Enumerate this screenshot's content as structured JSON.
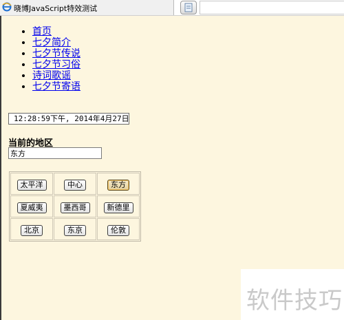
{
  "window": {
    "tab_title": "晓博JavaScript特效测试"
  },
  "nav": {
    "items": [
      {
        "label": "首页"
      },
      {
        "label": "七夕简介"
      },
      {
        "label": "七夕节传说"
      },
      {
        "label": "七夕节习俗"
      },
      {
        "label": "诗词歌谣"
      },
      {
        "label": "七夕节寄语"
      }
    ]
  },
  "clock": {
    "text": "12:28:59下午, 2014年4月27日"
  },
  "region": {
    "title": "当前的地区",
    "value": "东方"
  },
  "grid": {
    "rows": [
      [
        "太平洋",
        "中心",
        "东方"
      ],
      [
        "夏威夷",
        "墨西哥",
        "新德里"
      ],
      [
        "北京",
        "东京",
        "伦敦"
      ]
    ],
    "selected": "东方"
  },
  "watermark": {
    "text": "软件技巧"
  },
  "colors": {
    "page_background": "#fdf6df",
    "link": "#0000ee"
  }
}
